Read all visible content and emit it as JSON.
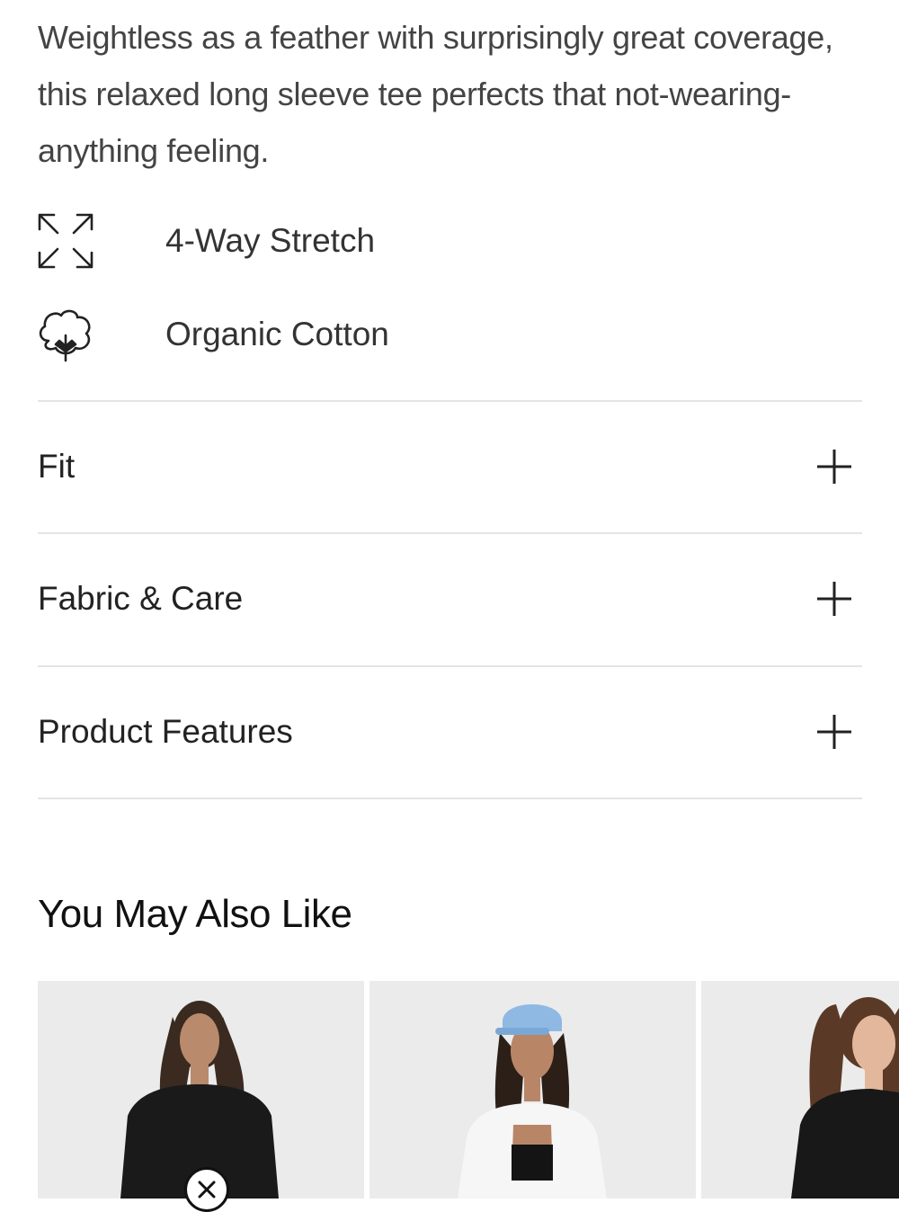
{
  "product": {
    "description": "Weightless as a feather with surprisingly great coverage, this relaxed long sleeve tee perfects that not-wearing-anything feeling.",
    "features": [
      {
        "icon": "stretch-arrows-icon",
        "label": "4-Way Stretch"
      },
      {
        "icon": "cotton-boll-icon",
        "label": "Organic Cotton"
      }
    ]
  },
  "accordion": {
    "items": [
      {
        "label": "Fit",
        "icon": "plus-icon"
      },
      {
        "label": "Fabric & Care",
        "icon": "plus-icon"
      },
      {
        "label": "Product Features",
        "icon": "plus-icon"
      }
    ]
  },
  "recommendations": {
    "title": "You May Also Like",
    "cards": [
      {
        "image": "model-black-long-sleeve-tee"
      },
      {
        "image": "model-blue-cap-white-shirt"
      },
      {
        "image": "model-black-tee"
      }
    ],
    "close_icon": "close-icon"
  },
  "colors": {
    "text": "#444444",
    "divider": "#e4e4e4",
    "card_bg": "#ececec"
  }
}
